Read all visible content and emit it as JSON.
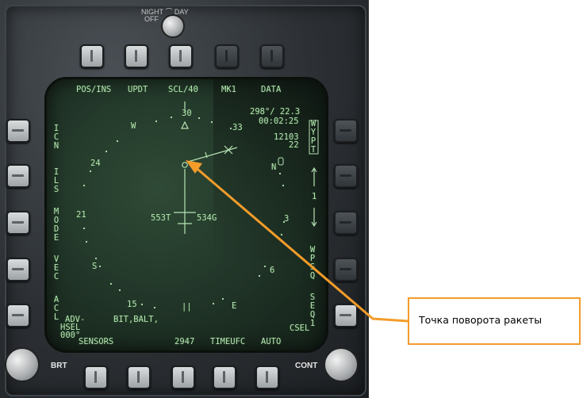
{
  "top_switch": {
    "label_line1": "NIGHT ⌒ DAY",
    "label_line2": "OFF"
  },
  "top_labels": [
    "POS/INS",
    "UPDT",
    "SCL/40",
    "MK1",
    "DATA"
  ],
  "left_labels": [
    "ICN",
    "ILS",
    "MODE",
    "VEC",
    "ACL"
  ],
  "right_labels": {
    "wpt_box": "WYPT",
    "arrow_num": "1",
    "wpsq": "WPSQ",
    "seq": "SEQ1"
  },
  "bottom_labels": [
    "SENSORS",
    "2947",
    "TIMEUFC",
    "AUTO"
  ],
  "csel": "CSEL",
  "readouts": {
    "bearing_range": "298°/ 22.3",
    "time": "00:02:25",
    "alt": "12103",
    "alt2": "22"
  },
  "compass": {
    "n30": "30",
    "n33": "33",
    "w": "W",
    "n24": "24",
    "n21": "21",
    "s": "S",
    "n15": "15",
    "e": "E",
    "n3": "3",
    "n6": "6",
    "n_mark": "N"
  },
  "center": {
    "tas": "553T",
    "gs": "534G"
  },
  "lower_left": {
    "adv": "ADV-",
    "bit": "BIT,BALT,",
    "hsel": "HSEL",
    "hsel_val": "000°"
  },
  "knobs": {
    "brt": "BRT",
    "cont": "CONT"
  },
  "callout": {
    "text": "Точка поворота ракеты",
    "color": "#f39c2a"
  },
  "colors": {
    "symbology": "#b7e4b4",
    "screen": "#243a2b"
  }
}
